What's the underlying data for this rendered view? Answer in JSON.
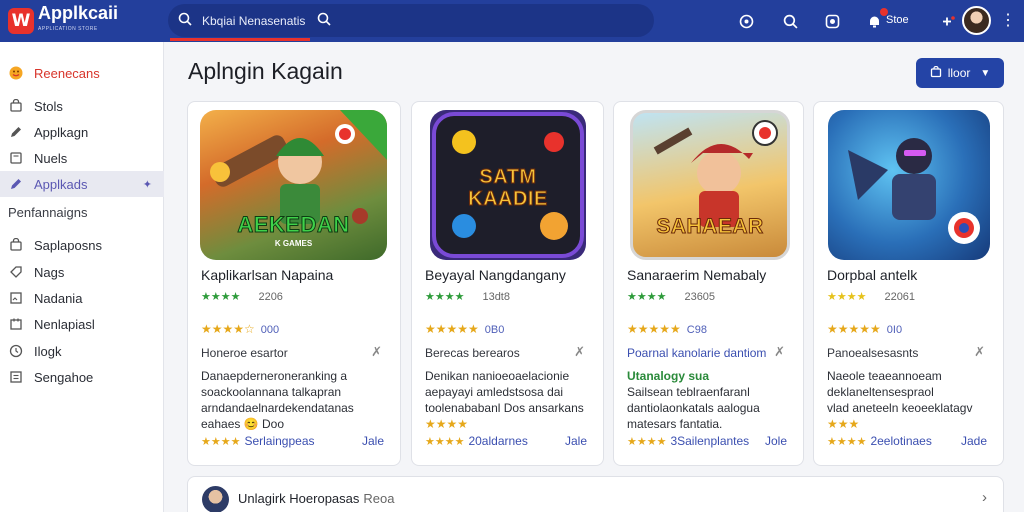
{
  "app": {
    "name": "Applkcaii",
    "tagline": "APPLICATION STORE"
  },
  "search": {
    "text": "Kbqiai Nenasenatis"
  },
  "header": {
    "store_label": "Stoe"
  },
  "sidebar": {
    "top_item": "Reenecans",
    "items": [
      {
        "label": "Stols",
        "icon": "cart-icon"
      },
      {
        "label": "Applkagn",
        "icon": "pencil-icon"
      },
      {
        "label": "Nuels",
        "icon": "book-icon"
      },
      {
        "label": "Applkads",
        "icon": "pencil-icon",
        "active": true
      }
    ],
    "section_label": "Penfannaigns",
    "section_items": [
      {
        "label": "Saplaposns",
        "icon": "cart-icon"
      },
      {
        "label": "Nags",
        "icon": "tag-icon"
      },
      {
        "label": "Nadania",
        "icon": "image-icon"
      },
      {
        "label": "Nenlapiasl",
        "icon": "doc-icon"
      },
      {
        "label": "Ilogk",
        "icon": "clock-icon"
      },
      {
        "label": "Sengahoe",
        "icon": "list-icon"
      }
    ]
  },
  "main": {
    "title": "Aplngin Kagain",
    "action_button": "lloor"
  },
  "cards": [
    {
      "art_title": "AEKEDAN",
      "art_sub": "K GAMES",
      "title": "Kaplikarlsan Napaina",
      "rating_top": "2206",
      "rating_mid": "000",
      "subtitle": "Honeroe esartor",
      "desc": "Danaepderneroneranking a",
      "desc2": "soackoolannana talkapran",
      "desc3": "arndandaelnardekendatanas",
      "desc4": "eahaes 😊 Doo",
      "desc_highlight": "",
      "foot_label": "Serlaingpeas",
      "more": "Jale"
    },
    {
      "art_title": "SATM KAADIE",
      "art_sub": "",
      "title": "Beyayal Nangdangany",
      "rating_top": "13dt8",
      "rating_mid": "0B0",
      "subtitle": "Berecas berearos",
      "desc": "Denikan nanioeoaelacionie",
      "desc2": "aepayayi amledstsosa dai",
      "desc3": "toolenababanl Dos ansarkans",
      "desc4": "",
      "desc_highlight": "",
      "foot_label": "20aldarnes",
      "more": "Jale"
    },
    {
      "art_title": "SAHAEAR",
      "art_sub": "",
      "title": "Sanaraerim Nemabaly",
      "rating_top": "23605",
      "rating_mid": "C98",
      "subtitle": "Poarnal kanolarie dantiom",
      "desc": "",
      "desc2": "Sailsean teblraenfaranl",
      "desc3": "dantiolaonkatals aalogua",
      "desc4": "matesars fantatia.",
      "desc_highlight": "Utanalogy sua",
      "foot_label": "3Sailenplantes",
      "more": "Jole"
    },
    {
      "art_title": "",
      "art_sub": "",
      "title": "Dorpbal antelk",
      "rating_top": "22061",
      "rating_mid": "0I0",
      "subtitle": "Panoealsesasnts",
      "desc": "Naeole teaeannoeam",
      "desc2": "deklaneltensespraol",
      "desc3": "vlad aneteeln keoeeklatagv",
      "desc4": "",
      "desc_highlight": "",
      "foot_label": "2eelotinaes",
      "more": "Jade"
    }
  ],
  "bottom": {
    "text": "Unlagirk Hoeropasas",
    "muted": "Reoa"
  },
  "colors": {
    "topbar": "#233f9c",
    "accent": "#2444a6",
    "brand_red": "#e8322c",
    "active_text": "#5b58b3",
    "star": "#e6a81b"
  }
}
